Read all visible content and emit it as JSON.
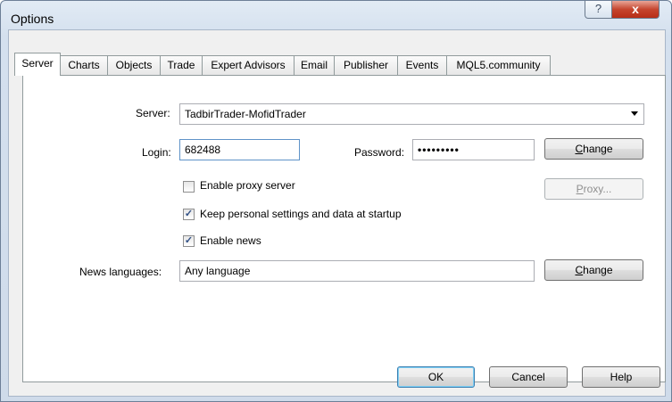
{
  "window": {
    "title": "Options",
    "help_glyph": "?",
    "close_glyph": "x"
  },
  "tabs": [
    {
      "label": "Server"
    },
    {
      "label": "Charts"
    },
    {
      "label": "Objects"
    },
    {
      "label": "Trade"
    },
    {
      "label": "Expert Advisors"
    },
    {
      "label": "Email"
    },
    {
      "label": "Publisher"
    },
    {
      "label": "Events"
    },
    {
      "label": "MQL5.community"
    }
  ],
  "active_tab": "Server",
  "server": {
    "server_label": "Server:",
    "server_value": "TadbirTrader-MofidTrader",
    "login_label": "Login:",
    "login_value": "682488",
    "password_label": "Password:",
    "password_value": "•••••••••",
    "change_label_first": "C",
    "change_label_rest": "hange",
    "proxy_button_first": "P",
    "proxy_button_rest": "roxy...",
    "enable_proxy": {
      "label": "Enable proxy server",
      "checked": false
    },
    "keep_settings": {
      "label": "Keep personal settings and data at startup",
      "checked": true
    },
    "enable_news": {
      "label": "Enable news",
      "checked": true
    },
    "news_languages_label": "News languages:",
    "news_languages_value": "Any language",
    "check_glyph": "✓"
  },
  "footer": {
    "ok": "OK",
    "cancel": "Cancel",
    "help": "Help"
  }
}
